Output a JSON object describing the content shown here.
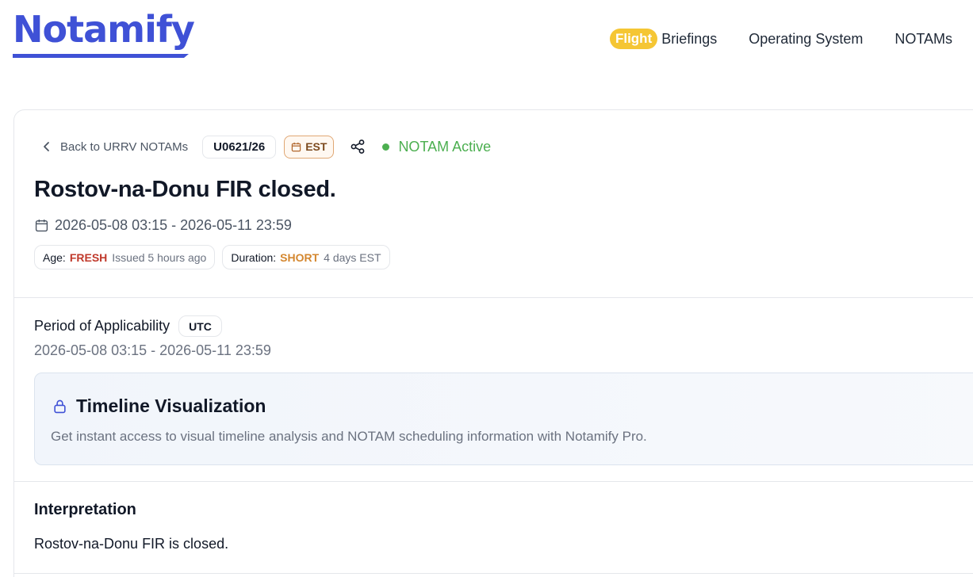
{
  "brand": {
    "logo_text": "Notamify",
    "accent_color": "#3f51d6"
  },
  "nav": {
    "flight_pill": "Flight",
    "briefings": "Briefings",
    "operating_system": "Operating System",
    "notams": "NOTAMs"
  },
  "notam": {
    "back_label": "Back to URRV NOTAMs",
    "id": "U0621/26",
    "est_label": "EST",
    "status": "NOTAM Active",
    "status_color": "#4caf50",
    "title": "Rostov-na-Donu FIR closed.",
    "date_range": "2026-05-08 03:15 - 2026-05-11 23:59",
    "age": {
      "label": "Age:",
      "value": "FRESH",
      "detail": "Issued 5 hours ago"
    },
    "duration": {
      "label": "Duration:",
      "value": "SHORT",
      "detail": "4 days EST"
    }
  },
  "applicability": {
    "label": "Period of Applicability",
    "tz": "UTC",
    "dates": "2026-05-08 03:15 - 2026-05-11 23:59"
  },
  "pro_box": {
    "icon": "lock-icon",
    "title": "Timeline Visualization",
    "text": "Get instant access to visual timeline analysis and NOTAM scheduling information with Notamify Pro."
  },
  "interpretation": {
    "title": "Interpretation",
    "text": "Rostov-na-Donu FIR is closed."
  }
}
